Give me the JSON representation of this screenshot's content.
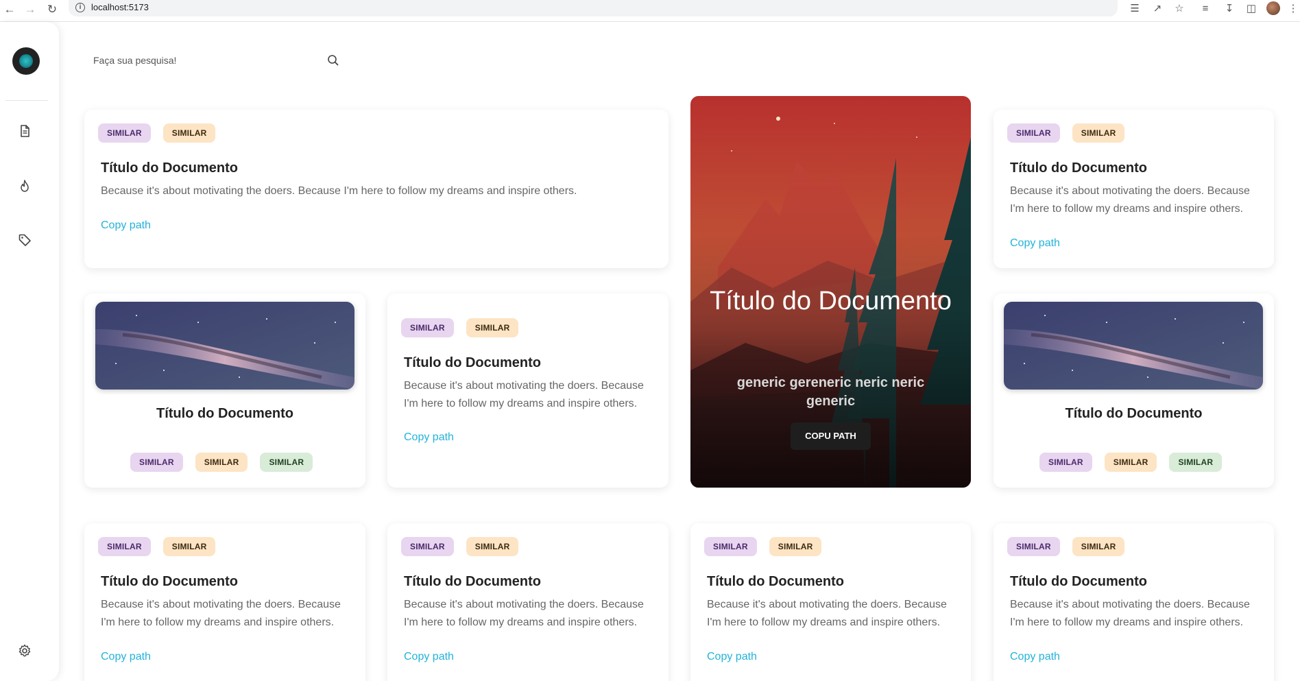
{
  "browser": {
    "url": "localhost:5173"
  },
  "sidebar": {
    "items": [
      {
        "icon": "document-icon"
      },
      {
        "icon": "flame-icon"
      },
      {
        "icon": "tag-icon"
      },
      {
        "icon": "gear-icon"
      }
    ]
  },
  "search": {
    "placeholder": "Faça sua pesquisa!"
  },
  "cards": {
    "text_top_left": {
      "badges": [
        "SIMILAR",
        "SIMILAR"
      ],
      "title": "Título do Documento",
      "description": "Because it's about motivating the doers. Because I'm here to follow my dreams and inspire others.",
      "link": "Copy path"
    },
    "text_top_right": {
      "badges": [
        "SIMILAR",
        "SIMILAR"
      ],
      "title": "Título do Documento",
      "description": "Because it's about motivating the doers. Because I'm here to follow my dreams and inspire others.",
      "link": "Copy path"
    },
    "image_left": {
      "title": "Título do Documento",
      "badges": [
        "SIMILAR",
        "SIMILAR",
        "SIMILAR"
      ]
    },
    "text_middle": {
      "badges": [
        "SIMILAR",
        "SIMILAR"
      ],
      "title": "Título do Documento",
      "description": "Because it's about motivating the doers. Because I'm here to follow my dreams and inspire others.",
      "link": "Copy path"
    },
    "image_right": {
      "title": "Título do Documento",
      "badges": [
        "SIMILAR",
        "SIMILAR",
        "SIMILAR"
      ]
    },
    "feature": {
      "title": "Título do Documento",
      "subtitle": "generic gereneric neric neric generic",
      "button": "COPU PATH"
    },
    "bottom_row": [
      {
        "badges": [
          "SIMILAR",
          "SIMILAR"
        ],
        "title": "Título do Documento",
        "description": "Because it's about motivating the doers. Because I'm here to follow my dreams and inspire others.",
        "link": "Copy path"
      },
      {
        "badges": [
          "SIMILAR",
          "SIMILAR"
        ],
        "title": "Título do Documento",
        "description": "Because it's about motivating the doers. Because I'm here to follow my dreams and inspire others.",
        "link": "Copy path"
      },
      {
        "badges": [
          "SIMILAR",
          "SIMILAR"
        ],
        "title": "Título do Documento",
        "description": "Because it's about motivating the doers. Because I'm here to follow my dreams and inspire others.",
        "link": "Copy path"
      },
      {
        "badges": [
          "SIMILAR",
          "SIMILAR"
        ],
        "title": "Título do Documento",
        "description": "Because it's about motivating the doers. Because I'm here to follow my dreams and inspire others.",
        "link": "Copy path"
      }
    ]
  },
  "colors": {
    "link": "#22b3d9",
    "badge_purple": "#e8d5f0",
    "badge_orange": "#fde4c4",
    "badge_green": "#d8ecd8"
  }
}
